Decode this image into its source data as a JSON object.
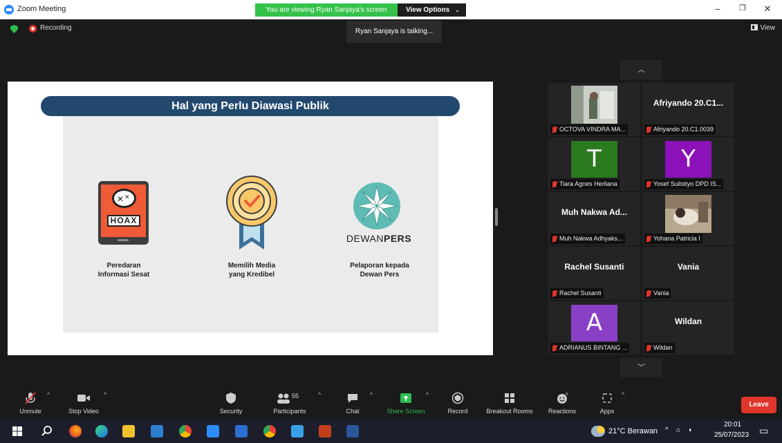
{
  "window": {
    "title": "Zoom Meeting"
  },
  "banner": {
    "viewing": "You are viewing Ryan Sanjaya's screen",
    "options": "View Options"
  },
  "status": {
    "recording": "Recording",
    "talking": "Ryan Sanjaya is talking...",
    "view": "View"
  },
  "slide": {
    "title": "Hal yang Perlu Diawasi Publik",
    "hoax_label": "HOAX",
    "dewan_logo": {
      "light": "DEWAN",
      "bold": "PERS"
    },
    "items": [
      {
        "line1": "Peredaran",
        "line2": "Informasi Sesat"
      },
      {
        "line1": "Memilih Media",
        "line2": "yang Kredibel"
      },
      {
        "line1": "Pelaporan kepada",
        "line2": "Dewan Pers"
      }
    ]
  },
  "gallery": {
    "tiles": [
      {
        "caption": "OCTOVA VINDRA MA...",
        "type": "video"
      },
      {
        "caption": "Afriyando 20.C1.0039",
        "big": "Afriyando 20.C1...",
        "type": "name"
      },
      {
        "caption": "Tiara Agnes Herliana",
        "letter": "T",
        "color": "#2b7a1f",
        "type": "letter"
      },
      {
        "caption": "Yosef Sulistiyo DPD IS...",
        "letter": "Y",
        "color": "#8a12b8",
        "type": "letter"
      },
      {
        "caption": "Muh Nakwa Adhyaks...",
        "big": "Muh Nakwa Ad...",
        "type": "name"
      },
      {
        "caption": "Yohana Patricia I",
        "type": "video"
      },
      {
        "caption": "Rachel Susanti",
        "big": "Rachel Susanti",
        "type": "name"
      },
      {
        "caption": "Vania",
        "big": "Vania",
        "type": "name"
      },
      {
        "caption": "ADRIANUS BINTANG ...",
        "letter": "A",
        "color": "#8a3fc7",
        "type": "letter"
      },
      {
        "caption": "Wildan",
        "big": "Wildan",
        "type": "name"
      }
    ]
  },
  "toolbar": {
    "unmute": "Unmute",
    "stop_video": "Stop Video",
    "security": "Security",
    "participants": "Participants",
    "participant_count": "55",
    "chat": "Chat",
    "share_screen": "Share Screen",
    "record": "Record",
    "breakout": "Breakout Rooms",
    "reactions": "Reactions",
    "apps": "Apps",
    "leave": "Leave"
  },
  "taskbar": {
    "weather": "21°C Berawan",
    "time": "20:01",
    "date": "25/07/2023"
  },
  "colors": {
    "accent_green": "#35c24a",
    "leave_red": "#e0352b",
    "slide_title_bg": "#23486e",
    "share_green": "#2dbb4e"
  }
}
